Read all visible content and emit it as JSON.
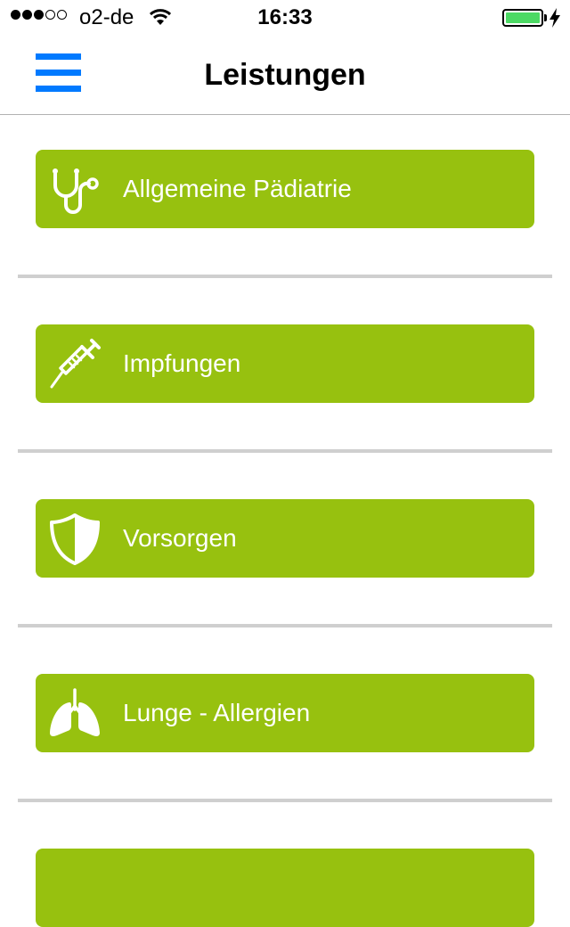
{
  "status_bar": {
    "carrier": "o2-de",
    "time": "16:33",
    "signal_bars_filled": 3,
    "signal_bars_total": 5,
    "battery_level": 1.0,
    "battery_color": "#4cd964",
    "charging": true
  },
  "nav": {
    "title": "Leistungen",
    "menu_icon": "hamburger-menu-icon",
    "accent_color": "#007aff"
  },
  "services": [
    {
      "label": "Allgemeine Pädiatrie",
      "icon": "stethoscope-icon"
    },
    {
      "label": "Impfungen",
      "icon": "syringe-icon"
    },
    {
      "label": "Vorsorgen",
      "icon": "shield-icon"
    },
    {
      "label": "Lunge - Allergien",
      "icon": "lungs-icon"
    }
  ],
  "theme": {
    "button_color": "#97c10f",
    "separator_color": "#cfcfcf"
  }
}
